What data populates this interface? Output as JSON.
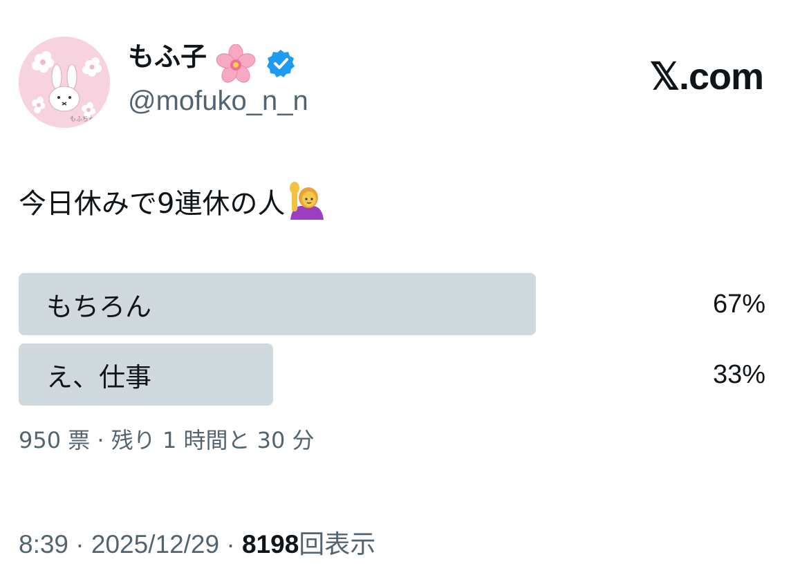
{
  "author": {
    "display_name": "もふ子",
    "handle": "@mofuko_n_n",
    "avatar_signature": "もふちゃん"
  },
  "brand": "𝕏.com",
  "post": {
    "text": "今日休みで9連休の人"
  },
  "poll": {
    "options": [
      {
        "label": "もちろん",
        "percent_text": "67%",
        "percent": 67
      },
      {
        "label": "え、仕事",
        "percent_text": "33%",
        "percent": 33
      }
    ],
    "summary": "950 票 · 残り 1 時間と 30 分"
  },
  "meta": {
    "time": "8:39",
    "separator1": " · ",
    "date": "2025/12/29",
    "separator2": " · ",
    "views_count": "8198",
    "views_label": "回表示"
  },
  "colors": {
    "poll_bar": "#cfd9de",
    "secondary_text": "#536471",
    "verified_blue": "#1d9bf0",
    "avatar_bg": "#f6d3de"
  },
  "icons": {
    "verified": "verified-badge-icon",
    "blossom": "cherry-blossom-emoji",
    "raise_hand": "person-raising-hand-emoji"
  }
}
